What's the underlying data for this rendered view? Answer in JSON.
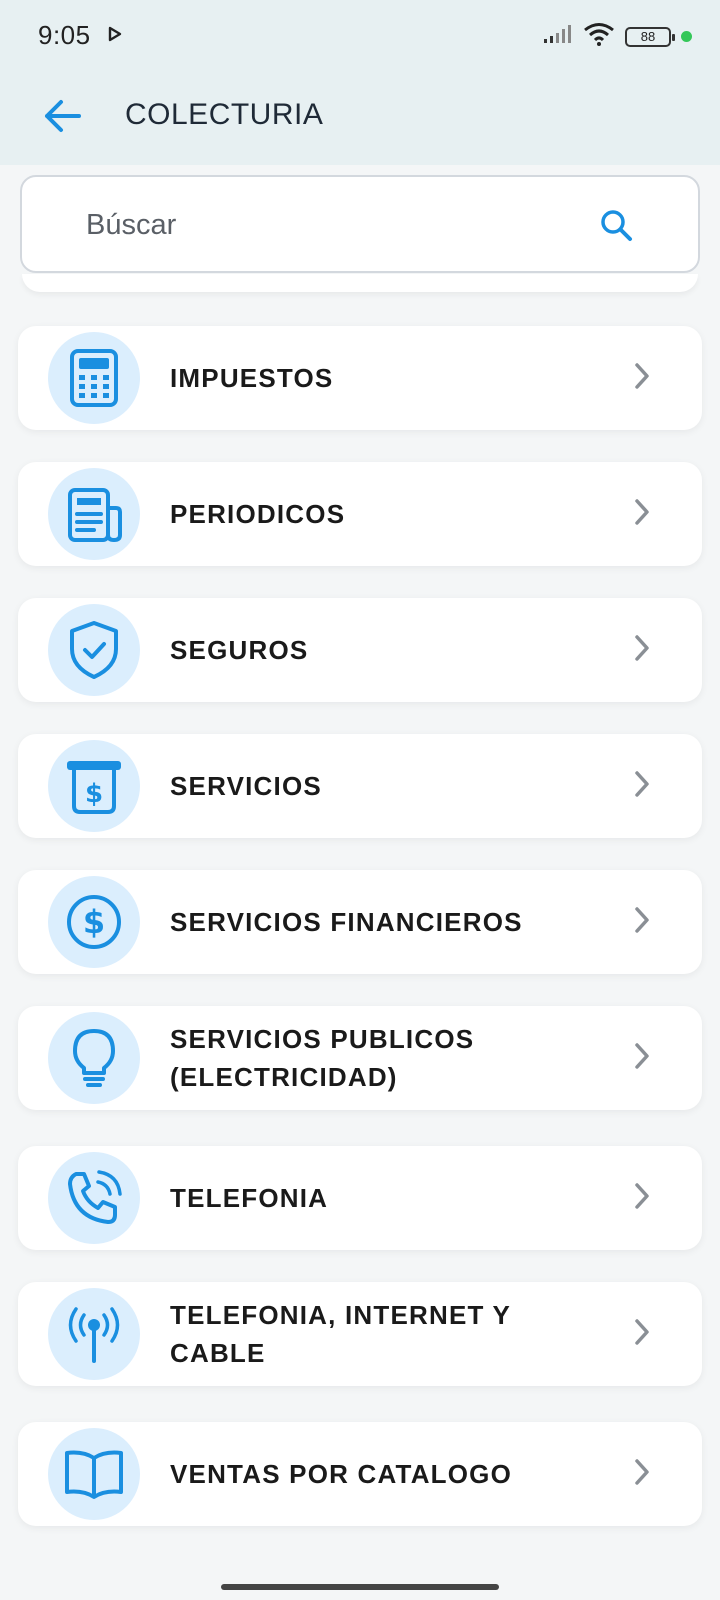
{
  "status": {
    "time": "9:05",
    "battery": "88"
  },
  "appbar": {
    "title": "COLECTURIA"
  },
  "search": {
    "placeholder": "Búscar"
  },
  "categories": [
    {
      "label": "IMPUESTOS",
      "icon": "calculator-icon"
    },
    {
      "label": "PERIODICOS",
      "icon": "newspaper-icon"
    },
    {
      "label": "SEGUROS",
      "icon": "shield-check-icon"
    },
    {
      "label": "SERVICIOS",
      "icon": "receipt-dollar-icon"
    },
    {
      "label": "SERVICIOS FINANCIEROS",
      "icon": "dollar-circle-icon"
    },
    {
      "label": "SERVICIOS PUBLICOS (ELECTRICIDAD)",
      "icon": "lightbulb-icon"
    },
    {
      "label": "TELEFONIA",
      "icon": "phone-ringing-icon"
    },
    {
      "label": "TELEFONIA, INTERNET Y CABLE",
      "icon": "antenna-icon"
    },
    {
      "label": "VENTAS POR CATALOGO",
      "icon": "open-book-icon"
    }
  ],
  "colors": {
    "accent": "#1a8fe0",
    "icon_bg": "#dbeefd",
    "header_bg": "#e7f0f2"
  }
}
